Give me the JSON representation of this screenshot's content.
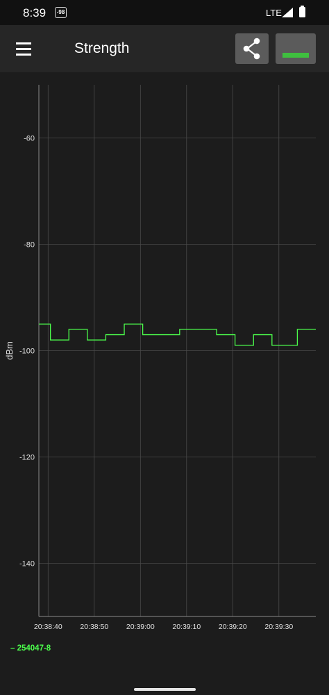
{
  "status_bar": {
    "time": "8:39",
    "signal_badge": "-98",
    "network": "LTE"
  },
  "app_bar": {
    "title": "Strength",
    "menu_icon": "menu-icon",
    "share_icon": "share-icon"
  },
  "chart_data": {
    "type": "line",
    "step": true,
    "ylabel": "dBm",
    "xlabel": "",
    "ylim": [
      -150,
      -50
    ],
    "yticks": [
      -60,
      -80,
      -100,
      -120,
      -140
    ],
    "xlim": [
      "20:38:38",
      "20:39:38"
    ],
    "xticks": [
      "20:38:40",
      "20:38:50",
      "20:39:00",
      "20:39:10",
      "20:39:20",
      "20:39:30"
    ],
    "grid": true,
    "legend_position": "bottom-left",
    "series": [
      {
        "name": "254047-8",
        "color": "#4cff4c",
        "x": [
          "20:38:38",
          "20:38:40.5",
          "20:38:44.5",
          "20:38:48.5",
          "20:38:52.5",
          "20:38:56.5",
          "20:39:00.5",
          "20:39:08.5",
          "20:39:16.5",
          "20:39:20.5",
          "20:39:24.5",
          "20:39:28.5",
          "20:39:34",
          "20:39:38"
        ],
        "values": [
          -95,
          -98,
          -96,
          -98,
          -97,
          -95,
          -97,
          -96,
          -97,
          -99,
          -97,
          -99,
          -96,
          -96
        ]
      }
    ]
  }
}
